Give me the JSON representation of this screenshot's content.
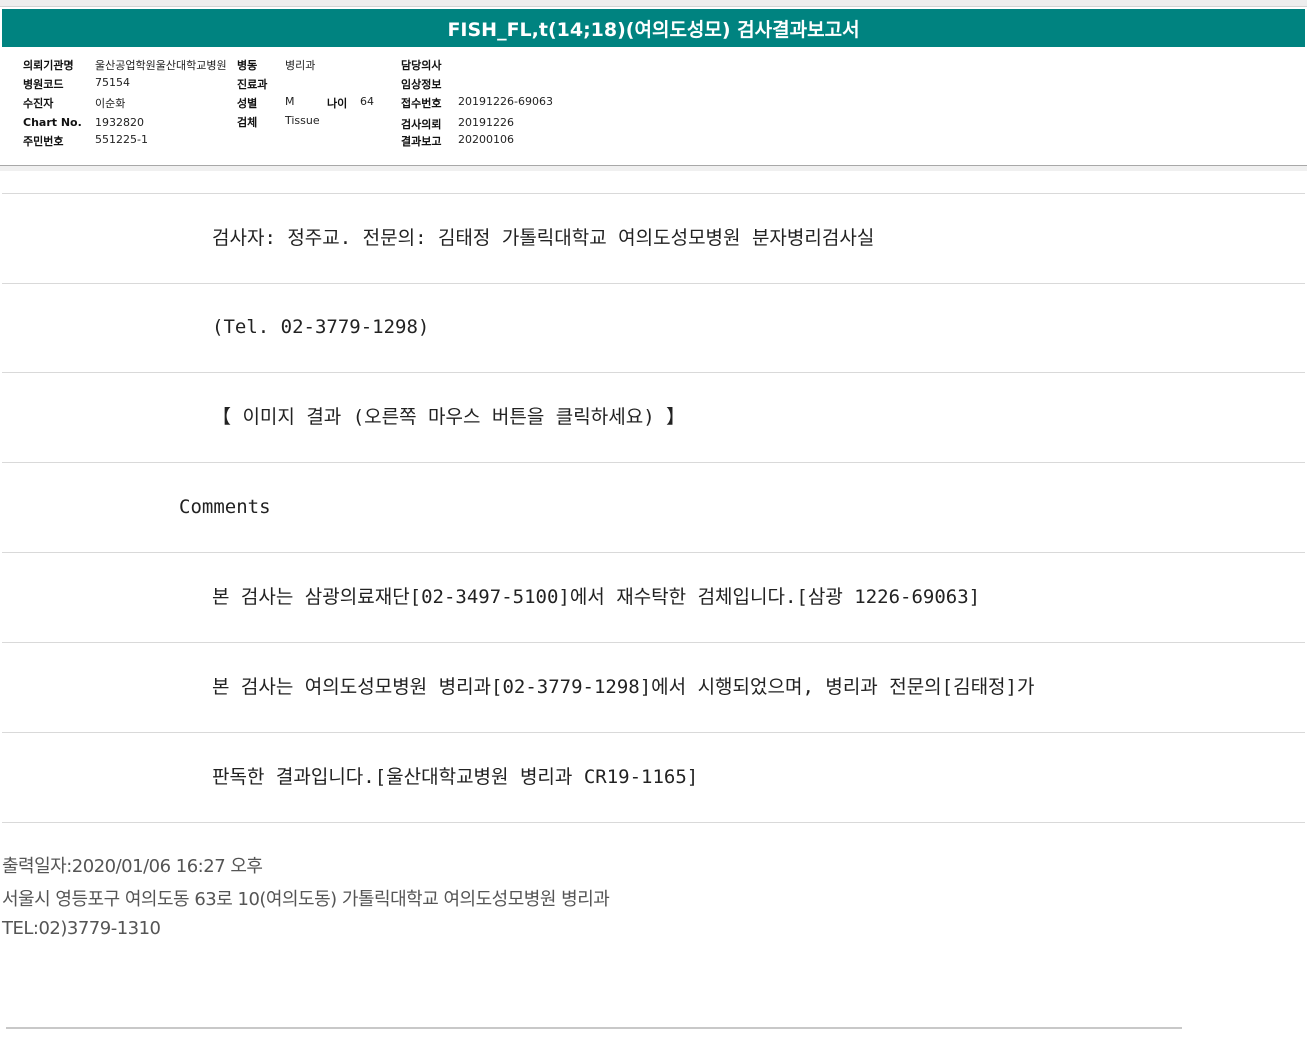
{
  "title": "FISH_FL,t(14;18)(여의도성모) 검사결과보고서",
  "info": {
    "institution_label": "의뢰기관명",
    "institution_value": "울산공업학원울산대학교병원",
    "ward_label": "병동",
    "ward_value": "병리과",
    "doctor_label": "담당의사",
    "doctor_value": "",
    "hospital_code_label": "병원코드",
    "hospital_code_value": "75154",
    "department_label": "진료과",
    "department_value": "",
    "clinical_info_label": "임상정보",
    "clinical_info_value": "",
    "patient_label": "수진자",
    "patient_value": "이순화",
    "sex_label": "성별",
    "sex_value": "M",
    "age_label": "나이",
    "age_value": "64",
    "receipt_label": "접수번호",
    "receipt_value": "20191226-69063",
    "chart_label": "Chart No.",
    "chart_value": "1932820",
    "specimen_label": "검체",
    "specimen_value": "Tissue",
    "request_label": "검사의뢰",
    "request_value": "20191226",
    "id_label": "주민번호",
    "id_value": "551225-1",
    "report_label": "결과보고",
    "report_value": "20200106"
  },
  "rows": [
    "검사자: 정주교. 전문의: 김태정 가톨릭대학교 여의도성모병원 분자병리검사실",
    "(Tel. 02-3779-1298)",
    "【 이미지 결과 (오른쪽 마우스 버튼을 클릭하세요) 】",
    "Comments",
    "본 검사는 삼광의료재단[02-3497-5100]에서 재수탁한 검체입니다.[삼광 1226-69063]",
    "본 검사는 여의도성모병원 병리과[02-3779-1298]에서 시행되었으며, 병리과 전문의[김태정]가",
    "판독한 결과입니다.[울산대학교병원 병리과 CR19-1165]"
  ],
  "footer": {
    "printed": "출력일자:2020/01/06 16:27 오후",
    "address": "서울시 영등포구 여의도동 63로 10(여의도동) 가톨릭대학교 여의도성모병원 병리과",
    "tel": "TEL:02)3779-1310"
  },
  "colors": {
    "title_bar": "#008380",
    "title_text": "#ffffff"
  }
}
